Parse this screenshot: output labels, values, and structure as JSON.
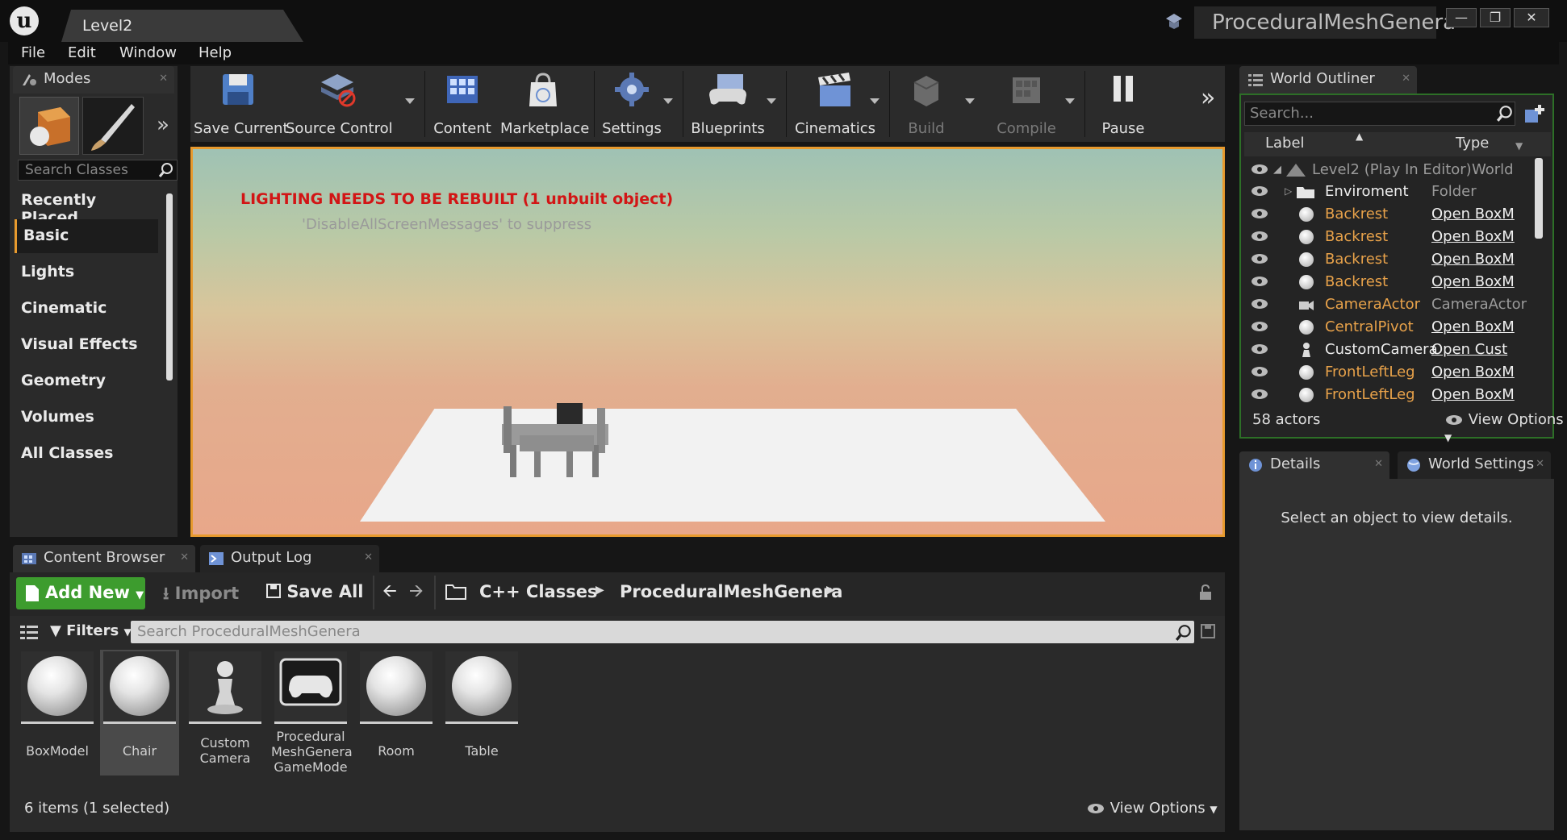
{
  "window": {
    "level_tab": "Level2",
    "project_name": "ProceduralMeshGenera"
  },
  "menu": [
    "File",
    "Edit",
    "Window",
    "Help"
  ],
  "modes": {
    "tab": "Modes",
    "search_placeholder": "Search Classes",
    "categories": [
      "Recently Placed",
      "Basic",
      "Lights",
      "Cinematic",
      "Visual Effects",
      "Geometry",
      "Volumes",
      "All Classes"
    ],
    "selected": "Basic"
  },
  "toolbar": {
    "save_current": "Save Current",
    "source_control": "Source Control",
    "content": "Content",
    "marketplace": "Marketplace",
    "settings": "Settings",
    "blueprints": "Blueprints",
    "cinematics": "Cinematics",
    "build": "Build",
    "compile": "Compile",
    "pause": "Pause"
  },
  "viewport": {
    "warning": "LIGHTING NEEDS TO BE REBUILT (1 unbuilt object)",
    "warning_sub": "'DisableAllScreenMessages' to suppress"
  },
  "outliner": {
    "tab": "World Outliner",
    "search_placeholder": "Search...",
    "col_label": "Label",
    "col_type": "Type",
    "rows": [
      {
        "label": "Level2 (Play In Editor)",
        "type": "World",
        "link": false
      },
      {
        "label": "Enviroment",
        "type": "Folder",
        "link": false
      },
      {
        "label": "Backrest",
        "type": "Open BoxM",
        "link": true
      },
      {
        "label": "Backrest",
        "type": "Open BoxM",
        "link": true
      },
      {
        "label": "Backrest",
        "type": "Open BoxM",
        "link": true
      },
      {
        "label": "Backrest",
        "type": "Open BoxM",
        "link": true
      },
      {
        "label": "CameraActor",
        "type": "CameraActor",
        "link": false
      },
      {
        "label": "CentralPivot",
        "type": "Open BoxM",
        "link": true
      },
      {
        "label": "CustomCamera",
        "type": "Open Cust",
        "link": true
      },
      {
        "label": "FrontLeftLeg",
        "type": "Open BoxM",
        "link": true
      },
      {
        "label": "FrontLeftLeg",
        "type": "Open BoxM",
        "link": true
      }
    ],
    "actors_count": "58 actors",
    "view_options": "View Options"
  },
  "details": {
    "tab": "Details",
    "world_settings_tab": "World Settings",
    "empty_msg": "Select an object to view details."
  },
  "content_browser": {
    "tab": "Content Browser",
    "output_log_tab": "Output Log",
    "add_new": "Add New",
    "import": "Import",
    "save_all": "Save All",
    "breadcrumb": [
      "C++ Classes",
      "ProceduralMeshGenera"
    ],
    "filters": "Filters",
    "search_placeholder": "Search ProceduralMeshGenera",
    "assets": [
      {
        "name": "BoxModel",
        "selected": false,
        "icon": "sphere"
      },
      {
        "name": "Chair",
        "selected": true,
        "icon": "sphere"
      },
      {
        "name": "Custom Camera",
        "selected": false,
        "icon": "pawn"
      },
      {
        "name": "Procedural MeshGenera GameMode",
        "selected": false,
        "icon": "gamepad"
      },
      {
        "name": "Room",
        "selected": false,
        "icon": "sphere"
      },
      {
        "name": "Table",
        "selected": false,
        "icon": "sphere"
      }
    ],
    "count": "6 items (1 selected)",
    "view_options": "View Options"
  },
  "colors": {
    "accent": "#e79a2e",
    "add_new": "#3d9c2e",
    "warning": "#d21515",
    "outliner_border": "#2d6f27"
  }
}
